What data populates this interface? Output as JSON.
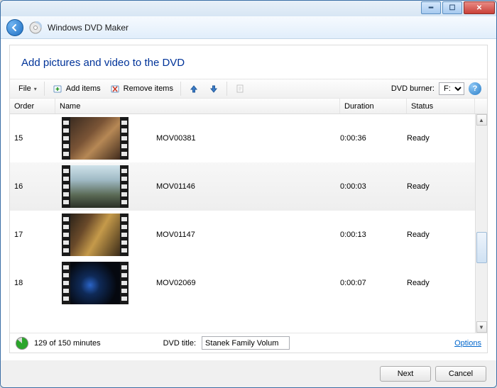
{
  "window": {
    "title": "Windows DVD Maker"
  },
  "header": {
    "main_title": "Add pictures and video to the DVD"
  },
  "toolbar": {
    "file_label": "File",
    "add_label": "Add items",
    "remove_label": "Remove items",
    "burner_label": "DVD burner:",
    "burner_value": "F:"
  },
  "columns": {
    "order": "Order",
    "name": "Name",
    "duration": "Duration",
    "status": "Status"
  },
  "items": [
    {
      "order": "15",
      "name": "MOV00381",
      "duration": "0:00:36",
      "status": "Ready",
      "thumb_bg": "linear-gradient(135deg,#3a2b20 0%,#7a5436 40%,#b68855 60%,#402a1c 100%)"
    },
    {
      "order": "16",
      "name": "MOV01146",
      "duration": "0:00:03",
      "status": "Ready",
      "thumb_bg": "linear-gradient(180deg,#cfe2ea 0%,#9fb9c4 35%,#5a6a55 70%,#2a2f25 100%)",
      "selected": true
    },
    {
      "order": "17",
      "name": "MOV01147",
      "duration": "0:00:13",
      "status": "Ready",
      "thumb_bg": "linear-gradient(120deg,#2b2218 0%,#6a4a2a 30%,#c59a4a 55%,#3a2a18 100%)"
    },
    {
      "order": "18",
      "name": "MOV02069",
      "duration": "0:00:07",
      "status": "Ready",
      "thumb_bg": "radial-gradient(circle at 40% 55%,#2a64c8 0%,#0f2a58 25%,#05080f 70%)"
    }
  ],
  "status": {
    "minutes_text": "129 of 150 minutes",
    "title_label": "DVD title:",
    "title_value": "Stanek Family Volum",
    "options_label": "Options"
  },
  "buttons": {
    "next": "Next",
    "cancel": "Cancel"
  }
}
